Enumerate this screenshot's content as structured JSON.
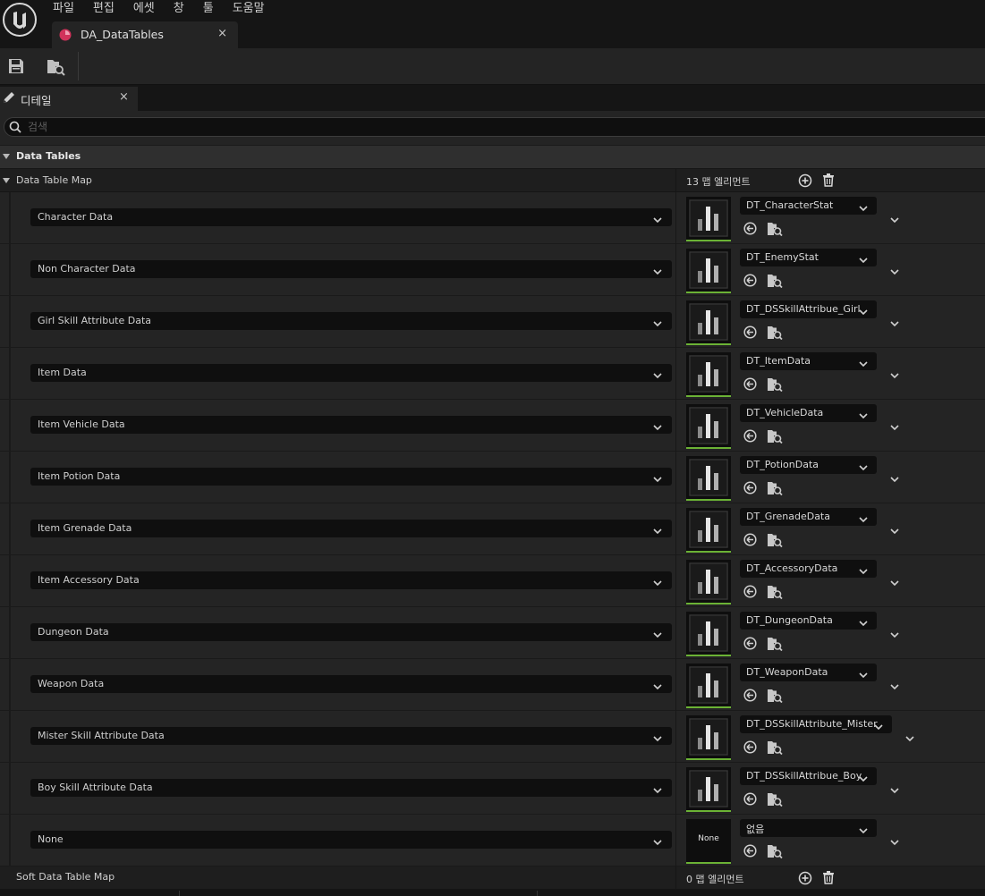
{
  "menu": [
    "파일",
    "편집",
    "에셋",
    "창",
    "툴",
    "도움말"
  ],
  "document_tab": {
    "name": "DA_DataTables",
    "close": "×"
  },
  "details_tab": {
    "label": "디테일",
    "close": "×"
  },
  "search": {
    "placeholder": "검색"
  },
  "category": {
    "label": "Data Tables"
  },
  "data_table_map": {
    "label": "Data Table Map",
    "count": "13 맵 엘리먼트"
  },
  "rows": [
    {
      "key": "Character Data",
      "value": "DT_CharacterStat"
    },
    {
      "key": "Non Character Data",
      "value": "DT_EnemyStat"
    },
    {
      "key": "Girl Skill Attribute Data",
      "value": "DT_DSSkillAttribue_Girl"
    },
    {
      "key": "Item Data",
      "value": "DT_ItemData"
    },
    {
      "key": "Item Vehicle Data",
      "value": "DT_VehicleData"
    },
    {
      "key": "Item Potion Data",
      "value": "DT_PotionData"
    },
    {
      "key": "Item Grenade Data",
      "value": "DT_GrenadeData"
    },
    {
      "key": "Item Accessory Data",
      "value": "DT_AccessoryData"
    },
    {
      "key": "Dungeon Data",
      "value": "DT_DungeonData"
    },
    {
      "key": "Weapon Data",
      "value": "DT_WeaponData"
    },
    {
      "key": "Mister Skill Attribute Data",
      "value": "DT_DSSkillAttribute_Mister"
    },
    {
      "key": "Boy Skill Attribute Data",
      "value": "DT_DSSkillAttribue_Boy"
    },
    {
      "key": "None",
      "value": "없음",
      "thumb_text": "None"
    }
  ],
  "soft_data_table_map": {
    "label": "Soft Data Table Map",
    "count": "0 맵 엘리먼트"
  },
  "colors": {
    "accent_green": "#6bb235",
    "asset_dot": "#d1335b"
  }
}
